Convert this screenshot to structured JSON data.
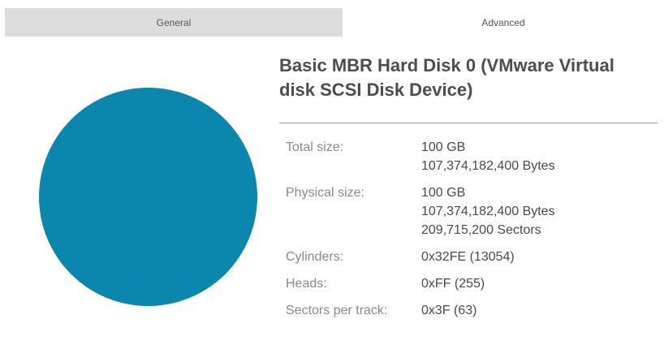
{
  "tabs": {
    "general": "General",
    "advanced": "Advanced"
  },
  "disk": {
    "title": "Basic MBR Hard Disk 0 (VMware Virtual disk SCSI Disk Device)",
    "circle_color": "#0b87ad"
  },
  "properties": [
    {
      "label": "Total size:",
      "values": [
        "100 GB",
        "107,374,182,400 Bytes"
      ]
    },
    {
      "label": "Physical size:",
      "values": [
        "100 GB",
        "107,374,182,400 Bytes",
        "209,715,200 Sectors"
      ]
    },
    {
      "label": "Cylinders:",
      "values": [
        "0x32FE (13054)"
      ]
    },
    {
      "label": "Heads:",
      "values": [
        "0xFF (255)"
      ]
    },
    {
      "label": "Sectors per track:",
      "values": [
        "0x3F (63)"
      ]
    }
  ]
}
